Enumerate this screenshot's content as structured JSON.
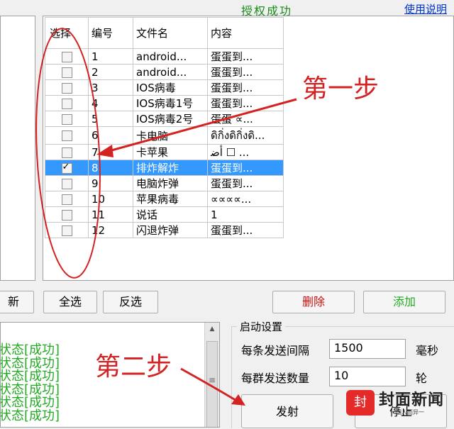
{
  "header": {
    "status": "授权成功",
    "help_link": "使用说明"
  },
  "table": {
    "headers": [
      "选择",
      "编号",
      "文件名",
      "内容"
    ],
    "rows": [
      {
        "num": "1",
        "name": "android...",
        "content": "蛋蛋到...",
        "checked": false
      },
      {
        "num": "2",
        "name": "android...",
        "content": "蛋蛋到...",
        "checked": false
      },
      {
        "num": "3",
        "name": "IOS病毒",
        "content": "蛋蛋到...",
        "checked": false
      },
      {
        "num": "4",
        "name": "IOS病毒1号",
        "content": "蛋蛋到...",
        "checked": false
      },
      {
        "num": "5",
        "name": "IOS病毒2号",
        "content": "蛋蛋 ∝...",
        "checked": false
      },
      {
        "num": "6",
        "name": "卡电脑",
        "content": "ดิกิ่งดิกิ่งดิ...",
        "checked": false
      },
      {
        "num": "7",
        "name": "卡苹果",
        "content": "ﺃﺿ ☐ ...",
        "checked": false
      },
      {
        "num": "8",
        "name": "排炸解炸",
        "content": "蛋蛋到...",
        "checked": true
      },
      {
        "num": "9",
        "name": "电脑炸弹",
        "content": "蛋蛋到...",
        "checked": false
      },
      {
        "num": "10",
        "name": "苹果病毒",
        "content": "∝∝∝∝...",
        "checked": false
      },
      {
        "num": "11",
        "name": "说话",
        "content": "1",
        "checked": false
      },
      {
        "num": "12",
        "name": "闪退炸弹",
        "content": "蛋蛋到...",
        "checked": false
      }
    ]
  },
  "buttons": {
    "left_partial": "新",
    "select_all": "全选",
    "invert": "反选",
    "delete": "删除",
    "add": "添加",
    "send": "发射",
    "stop": "停止"
  },
  "settings": {
    "group_title": "启动设置",
    "interval_label": "每条发送间隔",
    "interval_value": "1500",
    "interval_unit": "毫秒",
    "count_label": "每群发送数量",
    "count_value": "10",
    "count_unit": "轮"
  },
  "log": {
    "lines": [
      "状态[成功]",
      "状态[成功]",
      "状态[成功]",
      "状态[成功]",
      "状态[成功]",
      "状态[成功]"
    ]
  },
  "annotations": {
    "step1": "第一步",
    "step2": "第二步"
  },
  "watermark": {
    "text": "封面新闻",
    "sub": "一国人而异一"
  },
  "colors": {
    "selection": "#3399ff",
    "success_green": "#22aa22",
    "annotation_red": "#d42222"
  }
}
